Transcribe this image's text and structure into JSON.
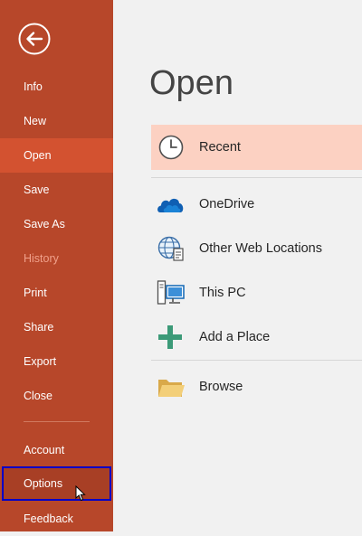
{
  "sidebar": {
    "back_icon": "back-arrow-icon",
    "items": [
      {
        "label": "Info"
      },
      {
        "label": "New"
      },
      {
        "label": "Open",
        "state": "selected"
      },
      {
        "label": "Save"
      },
      {
        "label": "Save As"
      },
      {
        "label": "History",
        "state": "disabled"
      },
      {
        "label": "Print"
      },
      {
        "label": "Share"
      },
      {
        "label": "Export"
      },
      {
        "label": "Close"
      },
      {
        "label": "Account"
      },
      {
        "label": "Options",
        "state": "focused"
      },
      {
        "label": "Feedback"
      }
    ]
  },
  "main": {
    "title": "Open",
    "locations": [
      {
        "label": "Recent",
        "icon": "clock-icon",
        "state": "selected"
      },
      {
        "label": "OneDrive",
        "icon": "cloud-icon"
      },
      {
        "label": "Other Web Locations",
        "icon": "globe-icon"
      },
      {
        "label": "This PC",
        "icon": "computer-icon"
      },
      {
        "label": "Add a Place",
        "icon": "plus-icon"
      },
      {
        "label": "Browse",
        "icon": "folder-icon"
      }
    ]
  },
  "colors": {
    "sidebar_bg": "#b7472a",
    "sidebar_selected": "#d35230",
    "location_selected": "#fcd1c2",
    "focus_outline": "#0000c8"
  }
}
